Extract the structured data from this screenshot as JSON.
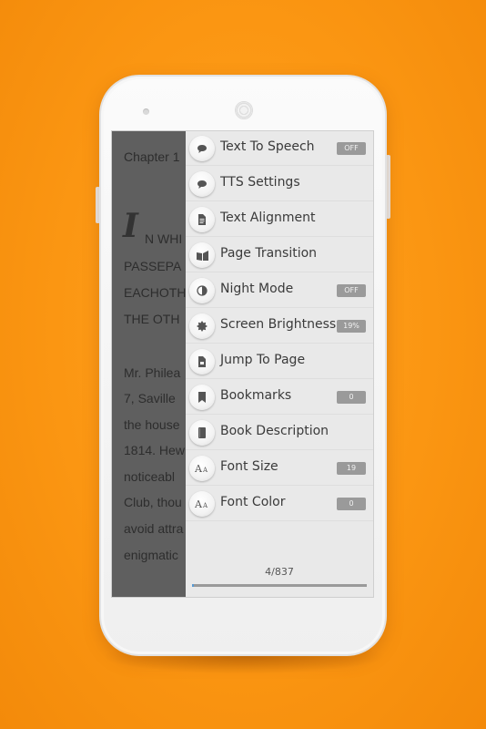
{
  "book": {
    "lines": [
      "Chapter 1",
      "N WHI",
      "PASSEPA",
      "EACHOTH",
      "THE OTH",
      "Mr. Philea",
      "7, Saville",
      "the house",
      "1814. Hew",
      "noticeabl",
      "Club, thou",
      "avoid attra",
      "enigmatic"
    ],
    "dropcap": "I"
  },
  "menu": {
    "items": [
      {
        "label": "Text To Speech",
        "badge": "OFF",
        "icon": "speech-bubble-icon"
      },
      {
        "label": "TTS Settings",
        "badge": "",
        "icon": "speech-bubble-icon"
      },
      {
        "label": "Text Alignment",
        "badge": "",
        "icon": "document-icon"
      },
      {
        "label": "Page Transition",
        "badge": "",
        "icon": "page-flip-icon"
      },
      {
        "label": "Night Mode",
        "badge": "OFF",
        "icon": "half-circle-icon"
      },
      {
        "label": "Screen Brightness",
        "badge": "19%",
        "icon": "brightness-icon"
      },
      {
        "label": "Jump To Page",
        "badge": "",
        "icon": "page-icon"
      },
      {
        "label": "Bookmarks",
        "badge": "0",
        "icon": "bookmark-icon"
      },
      {
        "label": "Book Description",
        "badge": "",
        "icon": "book-icon"
      },
      {
        "label": "Font Size",
        "badge": "19",
        "icon": "font-size-icon"
      },
      {
        "label": "Font Color",
        "badge": "0",
        "icon": "font-color-icon"
      }
    ],
    "page_count": "4/837",
    "progress_fraction": 0.005
  },
  "colors": {
    "background": "#fb9612",
    "progress": "#5a9bd3"
  }
}
